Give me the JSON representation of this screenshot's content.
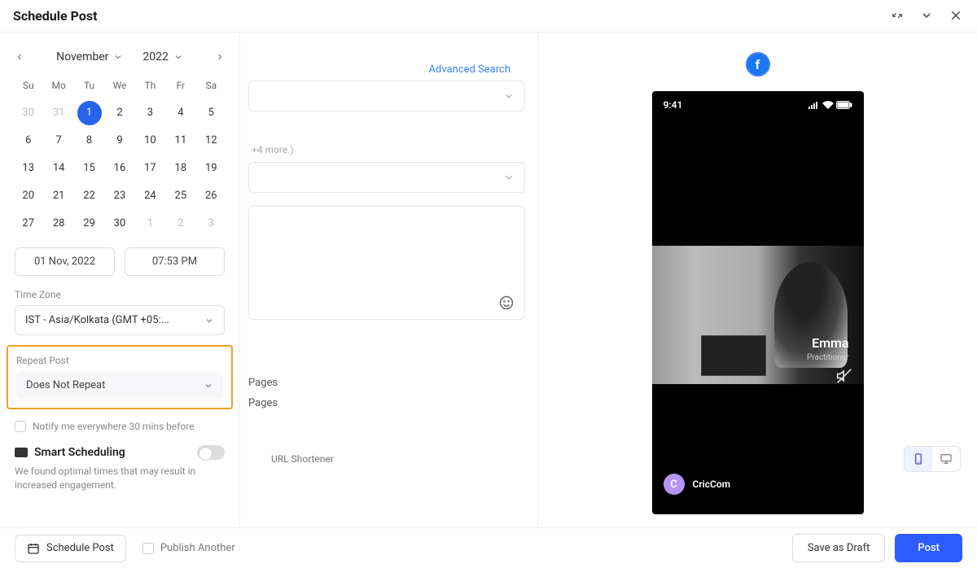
{
  "header": {
    "title": "Schedule Post"
  },
  "calendar": {
    "month": "November",
    "year": "2022",
    "days": [
      "Su",
      "Mo",
      "Tu",
      "We",
      "Th",
      "Fr",
      "Sa"
    ],
    "grid": [
      {
        "d": "30",
        "muted": true
      },
      {
        "d": "31",
        "muted": true
      },
      {
        "d": "1",
        "selected": true
      },
      {
        "d": "2"
      },
      {
        "d": "3"
      },
      {
        "d": "4"
      },
      {
        "d": "5"
      },
      {
        "d": "6"
      },
      {
        "d": "7"
      },
      {
        "d": "8"
      },
      {
        "d": "9"
      },
      {
        "d": "10"
      },
      {
        "d": "11"
      },
      {
        "d": "12"
      },
      {
        "d": "13"
      },
      {
        "d": "14"
      },
      {
        "d": "15"
      },
      {
        "d": "16"
      },
      {
        "d": "17"
      },
      {
        "d": "18"
      },
      {
        "d": "19"
      },
      {
        "d": "20"
      },
      {
        "d": "21"
      },
      {
        "d": "22"
      },
      {
        "d": "23"
      },
      {
        "d": "24"
      },
      {
        "d": "25"
      },
      {
        "d": "26"
      },
      {
        "d": "27"
      },
      {
        "d": "28"
      },
      {
        "d": "29"
      },
      {
        "d": "30"
      },
      {
        "d": "1",
        "muted": true
      },
      {
        "d": "2",
        "muted": true
      },
      {
        "d": "3",
        "muted": true
      }
    ],
    "date_value": "01 Nov, 2022",
    "time_value": "07:53 PM"
  },
  "timezone": {
    "label": "Time Zone",
    "value": "IST - Asia/Kolkata (GMT +05:..."
  },
  "repeat": {
    "label": "Repeat Post",
    "value": "Does Not Repeat"
  },
  "notify": {
    "label": "Notify me everywhere 30 mins before"
  },
  "smart": {
    "title": "Smart Scheduling",
    "desc": "We found optimal times that may result in increased engagement."
  },
  "middle": {
    "advanced_search": "Advanced Search",
    "more_text": "+4 more.)",
    "pages1": "Pages",
    "pages2": "Pages",
    "url_shortener": "URL Shortener"
  },
  "preview": {
    "status_time": "9:41",
    "name": "Emma",
    "subtitle_partial": "Practitioner",
    "footer_initial": "C",
    "footer_name": "CricCom"
  },
  "footer": {
    "schedule_post": "Schedule Post",
    "publish_another": "Publish Another",
    "save_draft": "Save as Draft",
    "post": "Post"
  }
}
